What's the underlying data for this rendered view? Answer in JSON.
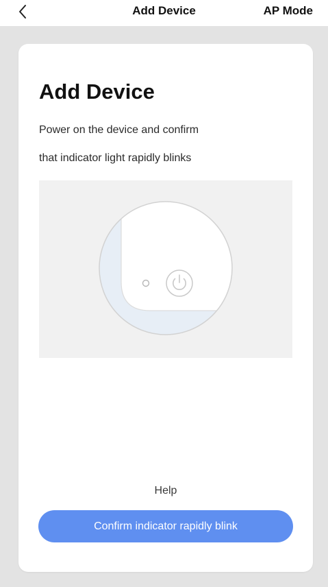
{
  "navbar": {
    "back_icon": "chevron-left-icon",
    "title": "Add Device",
    "mode_label": "AP Mode"
  },
  "card": {
    "title": "Add Device",
    "instruction_line1": "Power on the device and confirm",
    "instruction_line2": "that indicator light rapidly blinks",
    "illustration_icons": [
      "indicator-light-icon",
      "power-button-icon"
    ],
    "help_label": "Help",
    "confirm_label": "Confirm indicator rapidly blink"
  },
  "colors": {
    "accent": "#5f8ff0",
    "backdrop": "#e3e3e3",
    "card": "#ffffff",
    "illustration_bg": "#f1f1f1"
  }
}
